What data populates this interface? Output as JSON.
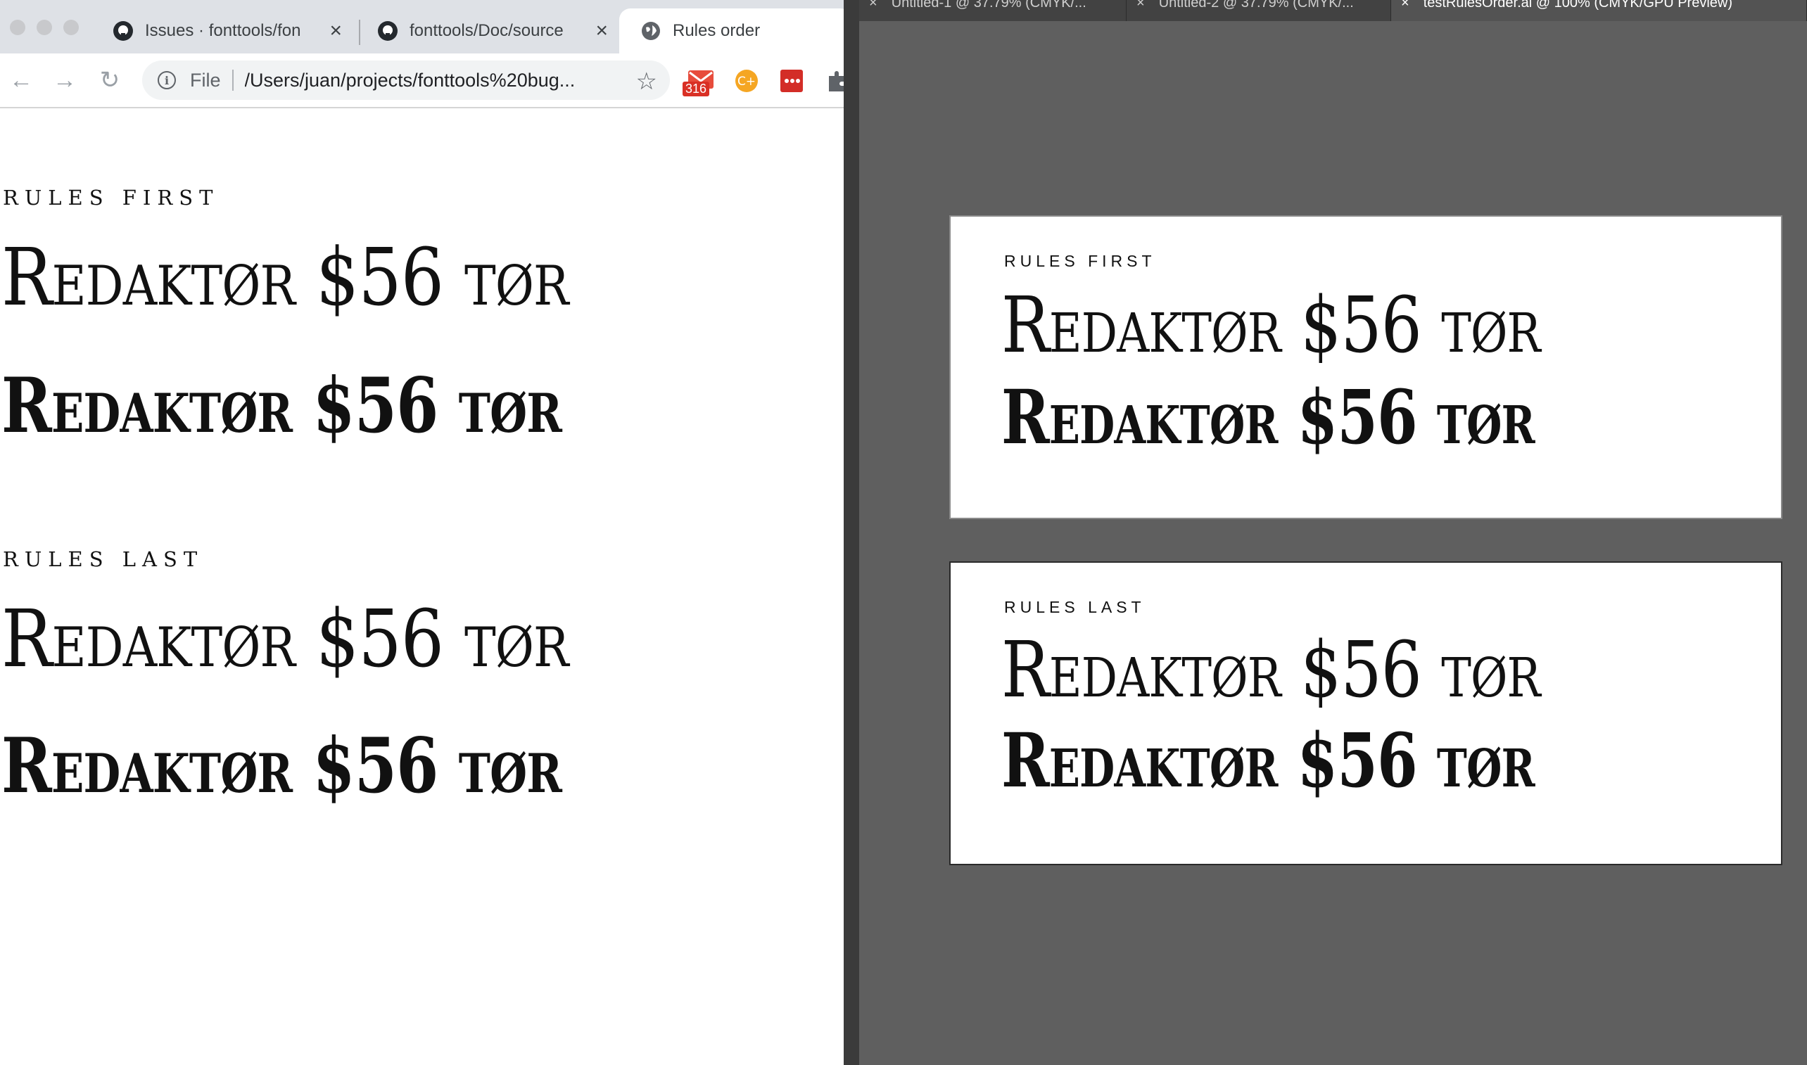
{
  "browser": {
    "tabs": [
      {
        "label": "Issues · fonttools/fon",
        "favicon": "github-icon"
      },
      {
        "label": "fonttools/Doc/source",
        "favicon": "github-icon"
      },
      {
        "label": "Rules order",
        "favicon": "globe-icon"
      }
    ],
    "omnibox": {
      "scheme_label": "File",
      "url": "/Users/juan/projects/fonttools%20bug..."
    },
    "extensions": {
      "mail_badge": "316"
    },
    "page": {
      "sections": [
        {
          "label": "RULES FIRST",
          "regular": "Redaktør $56 tør",
          "bold": "Redaktør $56 tør"
        },
        {
          "label": "RULES LAST",
          "regular": "Redaktør $56 tør",
          "bold": "Redaktør $56 tør"
        }
      ]
    }
  },
  "illustrator": {
    "tabs": [
      {
        "label": "Untitled-1 @ 37.79% (CMYK/..."
      },
      {
        "label": "Untitled-2 @ 37.79% (CMYK/..."
      },
      {
        "label": "testRulesOrder.ai @ 100% (CMYK/GPU Preview)"
      }
    ],
    "artboards": [
      {
        "label": "RULES FIRST",
        "regular": "Redaktør $56 tør",
        "bold": "Redaktør $56 tør"
      },
      {
        "label": "RULES LAST",
        "regular": "Redaktør $56 tør",
        "bold": "Redaktør $56 tør"
      }
    ]
  },
  "colors": {
    "tabstrip": "#dee1e6",
    "canvas": "#5f5f5f",
    "mail_badge": "#d93025"
  }
}
